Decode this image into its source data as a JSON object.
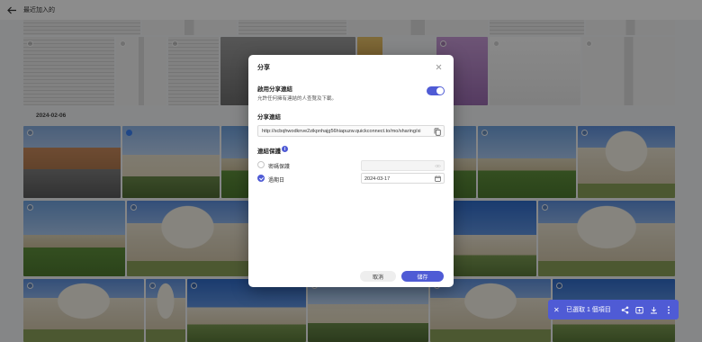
{
  "app": {
    "back_label": "←",
    "title": "最近加入的",
    "date_label": "2024-02-06"
  },
  "selection_bar": {
    "close_label": "✕",
    "status_text": "已選取 1 個項目"
  },
  "dialog": {
    "title": "分享",
    "close_label": "×",
    "enable_share_link": {
      "label": "啟用分享連結",
      "description": "允許任何擁有連結的人查覽及下載。",
      "enabled": true
    },
    "share_link": {
      "label": "分享連結",
      "url": "http://scbqhwodknve2zikpnhajg56hiapuzw.quickconnect.to/mo/sharing/xi"
    },
    "link_protection": {
      "label": "連結保護",
      "info_label": "i",
      "password": {
        "label": "密碼保護",
        "checked": false,
        "value": ""
      },
      "expiry": {
        "label": "過期日",
        "checked": true,
        "value": "2024-03-17"
      }
    },
    "buttons": {
      "cancel": "取消",
      "save": "儲存"
    }
  },
  "colors": {
    "accent": "#4f5bd5",
    "overlay": "#000000"
  }
}
